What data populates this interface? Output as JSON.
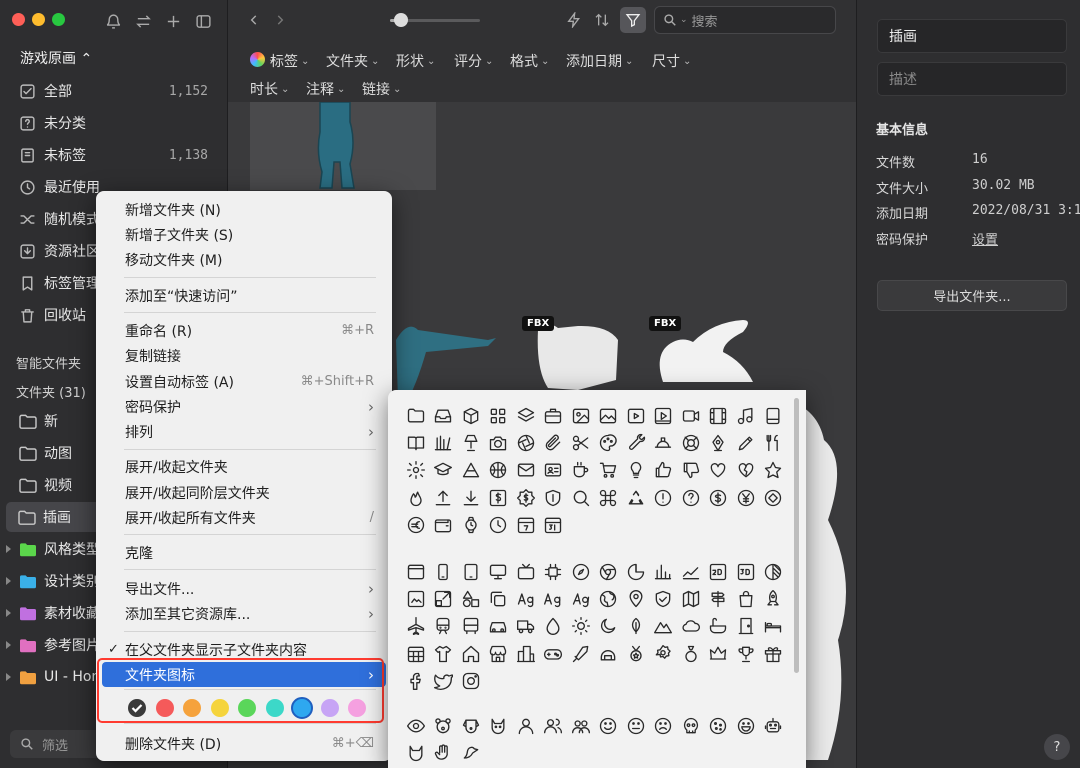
{
  "sidebar": {
    "library_name": "游戏原画 ⌃",
    "nav": [
      {
        "label": "全部",
        "count": "1,152",
        "icon": "inbox-icon"
      },
      {
        "label": "未分类",
        "count": "",
        "icon": "question-icon"
      },
      {
        "label": "未标签",
        "count": "1,138",
        "icon": "tag-icon"
      },
      {
        "label": "最近使用",
        "count": "",
        "icon": "clock-icon"
      },
      {
        "label": "随机模式",
        "count": "",
        "icon": "shuffle-icon"
      },
      {
        "label": "资源社区",
        "count": "",
        "icon": "download-icon"
      },
      {
        "label": "标签管理",
        "count": "",
        "icon": "bookmark-icon"
      },
      {
        "label": "回收站",
        "count": "",
        "icon": "trash-icon"
      }
    ],
    "smart_folders_label": "智能文件夹",
    "folders_label": "文件夹 (31)",
    "folders": [
      {
        "label": "新",
        "color": "#c8c8c8"
      },
      {
        "label": "动图",
        "color": "#c8c8c8"
      },
      {
        "label": "视频",
        "color": "#c8c8c8"
      },
      {
        "label": "插画",
        "color": "#c8c8c8"
      },
      {
        "label": "风格类型",
        "color": "#5bd64b"
      },
      {
        "label": "设计类别",
        "color": "#3ab0e8"
      },
      {
        "label": "素材收藏",
        "color": "#c070e0"
      },
      {
        "label": "参考图片",
        "color": "#e070c0"
      },
      {
        "label": "UI - Home",
        "color": "#f0a040"
      }
    ],
    "filter_placeholder": "筛选"
  },
  "toolbar": {
    "zoom_level": 0.12,
    "search_placeholder": "搜索"
  },
  "filters": {
    "row1": [
      "标签",
      "文件夹",
      "形状",
      "评分",
      "格式",
      "添加日期",
      "尺寸"
    ],
    "row2": [
      "时长",
      "注释",
      "链接"
    ]
  },
  "grid": {
    "badges": [
      "FBX",
      "FBX"
    ]
  },
  "context_menu": {
    "items": [
      {
        "label": "新增文件夹 (N)",
        "shortcut": "",
        "submenu": false
      },
      {
        "label": "新增子文件夹 (S)",
        "shortcut": "",
        "submenu": false
      },
      {
        "label": "移动文件夹 (M)",
        "shortcut": "",
        "submenu": false
      },
      {
        "label": "添加至“快速访问”",
        "shortcut": "",
        "submenu": false
      },
      {
        "label": "重命名 (R)",
        "shortcut": "⌘+R",
        "submenu": false
      },
      {
        "label": "复制链接",
        "shortcut": "",
        "submenu": false
      },
      {
        "label": "设置自动标签 (A)",
        "shortcut": "⌘+Shift+R",
        "submenu": false
      },
      {
        "label": "密码保护",
        "shortcut": "",
        "submenu": true
      },
      {
        "label": "排列",
        "shortcut": "",
        "submenu": true
      },
      {
        "label": "展开/收起文件夹",
        "shortcut": "",
        "submenu": false
      },
      {
        "label": "展开/收起同阶层文件夹",
        "shortcut": "",
        "submenu": false
      },
      {
        "label": "展开/收起所有文件夹",
        "shortcut": "/",
        "submenu": false
      },
      {
        "label": "克隆",
        "shortcut": "",
        "submenu": false
      },
      {
        "label": "导出文件...",
        "shortcut": "",
        "submenu": true
      },
      {
        "label": "添加至其它资源库...",
        "shortcut": "",
        "submenu": true
      },
      {
        "label": "在父文件夹显示子文件夹内容",
        "shortcut": "",
        "submenu": false,
        "checked": true
      },
      {
        "label": "文件夹图标",
        "shortcut": "",
        "submenu": true,
        "highlighted": true
      },
      {
        "label": "删除文件夹 (D)",
        "shortcut": "⌘+⌫",
        "submenu": false
      }
    ],
    "swatches": [
      "#3a3a3a",
      "#f55a5a",
      "#f5a23c",
      "#f5d43c",
      "#5ad65a",
      "#3cd8c8",
      "#2ea8f0",
      "#c7a4f5",
      "#f5a0e0"
    ],
    "selected_swatch": 6
  },
  "inspector": {
    "name_value": "插画",
    "desc_placeholder": "描述",
    "section_title": "基本信息",
    "props": [
      {
        "label": "文件数",
        "value": "16",
        "link": false
      },
      {
        "label": "文件大小",
        "value": "30.02 MB",
        "link": false
      },
      {
        "label": "添加日期",
        "value": "2022/08/31 3:1",
        "link": false
      },
      {
        "label": "密码保护",
        "value": "设置",
        "link": true
      }
    ],
    "export_button": "导出文件夹...",
    "help": "?"
  },
  "icon_picker": {
    "group1": [
      "folder",
      "inbox",
      "box",
      "grid",
      "layers",
      "briefcase",
      "image",
      "photo",
      "play",
      "play2",
      "video",
      "film",
      "music",
      "note",
      "book",
      "chart-bars",
      "lamp",
      "camera",
      "aperture",
      "paperclip",
      "scissors",
      "palette",
      "wrench",
      "hardhat",
      "lifebuoy",
      "pen-nib",
      "pen",
      "utensils",
      "gear",
      "mortarboard",
      "triangle",
      "basketball",
      "mail",
      "idcard",
      "coffee",
      "cart",
      "lightbulb",
      "thumbs-up",
      "thumbs-down",
      "heart",
      "heart-broken",
      "star",
      "flame",
      "upload",
      "download",
      "dollar",
      "dollar-badge",
      "shield",
      "search",
      "command",
      "recycle",
      "alert",
      "question",
      "dollar-circle",
      "yen",
      "diamond",
      "euro",
      "wallet",
      "watch",
      "clock",
      "cal-7",
      "cal-31"
    ],
    "group2": [
      "window",
      "phone",
      "tablet",
      "monitor",
      "tv",
      "chip",
      "compass",
      "chrome",
      "pie",
      "bars",
      "trend",
      "2d",
      "3d",
      "contrast",
      "photo2",
      "resize",
      "shapes",
      "copy",
      "ag1",
      "ag2",
      "ag3",
      "globe",
      "pin",
      "shield-check",
      "map",
      "signpost",
      "gift-bag",
      "rocket",
      "plane",
      "train",
      "bus",
      "car",
      "truck",
      "drop",
      "sun",
      "moon",
      "leaf",
      "mountain",
      "cloud",
      "bath",
      "door",
      "bed",
      "calendar-grid",
      "shirt",
      "home",
      "store",
      "city",
      "gamepad",
      "sword",
      "helmet",
      "medal",
      "badge",
      "ring",
      "crown",
      "trophy",
      "gift",
      "facebook",
      "twitter",
      "instagram"
    ],
    "group3": [
      "eye",
      "bear",
      "dog",
      "cat",
      "user",
      "users",
      "user-group",
      "smile",
      "meh",
      "frown",
      "skull",
      "cookie",
      "grin",
      "robot",
      "cat2",
      "hand",
      "bird"
    ]
  }
}
